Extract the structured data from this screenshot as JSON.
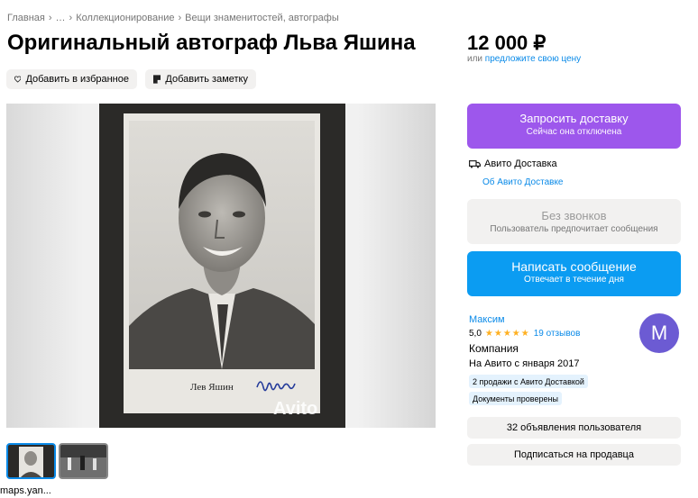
{
  "breadcrumb": {
    "items": [
      "Главная",
      "…",
      "Коллекционирование",
      "Вещи знаменитостей, автографы"
    ],
    "separator": "›"
  },
  "listing": {
    "title": "Оригинальный автограф Льва Яшина",
    "price": "12 000 ₽",
    "offer_prefix": "или",
    "offer_link": "предложите свою цену"
  },
  "actions": {
    "favorite_label": "Добавить в избранное",
    "note_label": "Добавить заметку"
  },
  "gallery": {
    "card_caption": "Лев Яшин",
    "watermark": "Avito",
    "thumb_caption": "maps.yan..."
  },
  "delivery": {
    "request_label": "Запросить доставку",
    "request_sub": "Сейчас она отключена",
    "service_label": "Авито Доставка",
    "about_link": "Об Авито Доставке"
  },
  "contact": {
    "no_calls_label": "Без звонков",
    "no_calls_sub": "Пользователь предпочитает сообщения",
    "message_label": "Написать сообщение",
    "message_sub": "Отвечает в течение дня"
  },
  "seller": {
    "name": "Максим",
    "rating": "5,0",
    "stars": "★★★★★",
    "reviews": "19 отзывов",
    "type": "Компания",
    "since": "На Авито с января 2017",
    "badge_sales": "2 продажи с Авито Доставкой",
    "badge_docs": "Документы проверены",
    "avatar_letter": "М",
    "ads_label": "32 объявления пользователя",
    "subscribe_label": "Подписаться на продавца"
  },
  "colors": {
    "purple": "#9d57ec",
    "blue": "#0b9cf2",
    "link": "#0a8ae8",
    "avatar": "#6c5bd3",
    "star": "#ffb021"
  }
}
